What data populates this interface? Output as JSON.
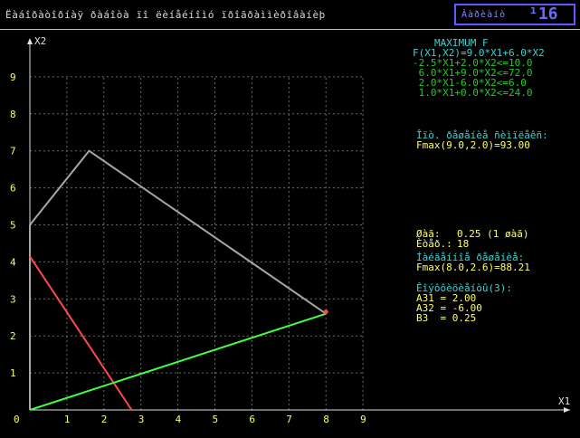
{
  "window": {
    "title": "Ëàáîðàòîðíàÿ ðàáîòà ïî ëèíåéíîìó ïðîãðàììèðîâàíèþ",
    "badge_small": "Âàðèàíò",
    "badge_big": "¹16"
  },
  "info": {
    "heading": "MAXIMUM F",
    "objective": "F(X1,X2)=9.0*X1+6.0*X2",
    "constraints": [
      "-2.5*X1+2.0*X2<=10.0",
      " 6.0*X1+9.0*X2<=72.0",
      " 2.0*X1-6.0*X2<=6.0",
      " 1.0*X1+0.0*X2<=24.0"
    ],
    "opt_label": "Îïò. ðåøåíèå ñèìïëåêñ:",
    "opt_value": "Fmax(9.0,2.0)=93.00",
    "step_label": "Øàã:",
    "step_value": "0.25 (1 øàã)",
    "iter_label": "Èòåð.:",
    "iter_value": "18",
    "found_label": "Íàéäåííîå ðåøåíèå:",
    "found_value": "Fmax(8.0,2.6)=88.21",
    "coef_label": "Êîýôôèöèåíòû(3):",
    "coefs": [
      "A31 = 2.00",
      "A32 = -6.00",
      "B3  = 0.25"
    ]
  },
  "chart_data": {
    "type": "line",
    "xlabel": "X1",
    "ylabel": "X2",
    "xlim": [
      0,
      9
    ],
    "ylim": [
      0,
      9
    ],
    "grid": true,
    "xticks": [
      "0",
      "1",
      "2",
      "3",
      "4",
      "5",
      "6",
      "7",
      "8",
      "9"
    ],
    "yticks": [
      "1",
      "2",
      "3",
      "4",
      "5",
      "6",
      "7",
      "8",
      "9"
    ],
    "series": [
      {
        "color": "#a6a6a6",
        "points": [
          [
            0,
            0
          ],
          [
            0,
            5
          ],
          [
            1.6,
            7
          ],
          [
            8.0,
            2.6
          ]
        ]
      },
      {
        "color": "#ff4a4a",
        "points": [
          [
            0,
            4.15
          ],
          [
            2.75,
            0
          ]
        ]
      },
      {
        "color": "#41ff41",
        "points": [
          [
            0,
            0
          ],
          [
            8.0,
            2.6
          ]
        ]
      }
    ],
    "markers": [
      {
        "color": "#ff4a4a",
        "point": [
          8.0,
          2.65
        ]
      }
    ],
    "colors": {
      "axis": "#e0e0e0",
      "grid": "#6b6b6b",
      "tick_text": "#ffff66"
    }
  }
}
